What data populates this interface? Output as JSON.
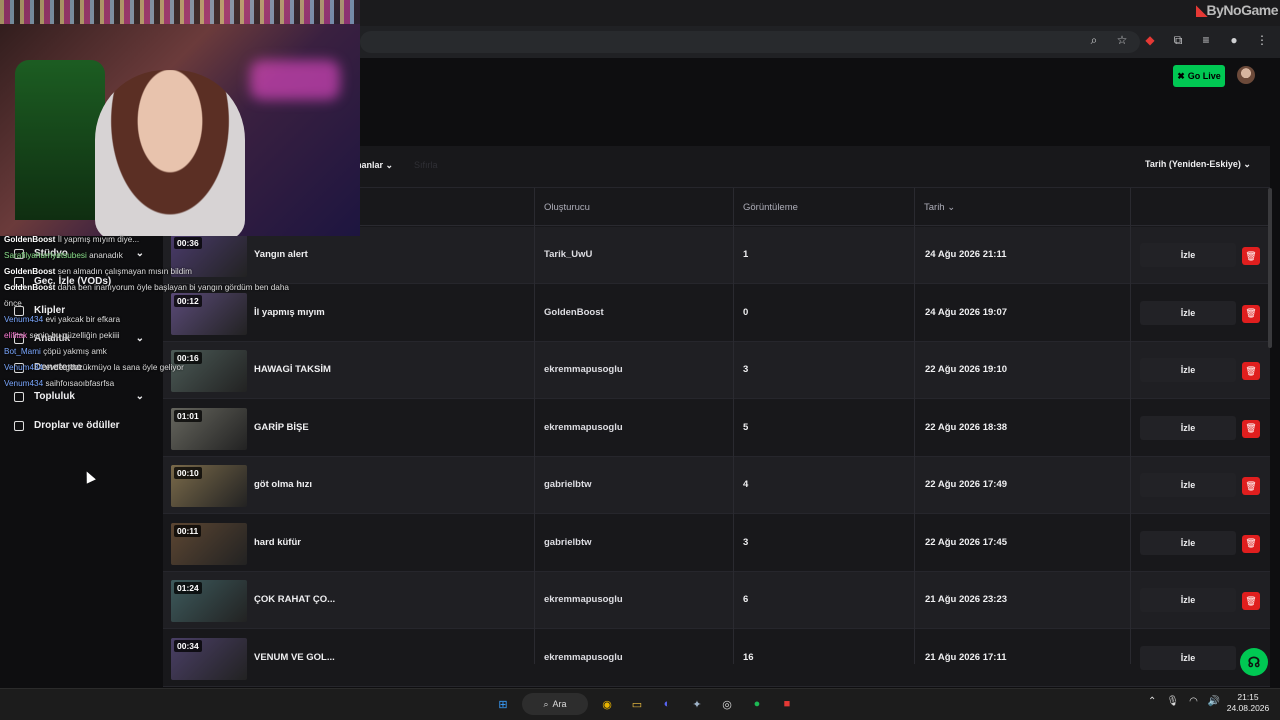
{
  "browser": {
    "watermark": "ByNoGame",
    "icons": [
      "zoom-icon",
      "star-icon",
      "extension-icon",
      "puzzle-icon",
      "media-icon",
      "profile-icon",
      "menu-icon"
    ]
  },
  "header": {
    "go_live_label": "Go Live"
  },
  "sidebar": {
    "items": [
      {
        "label": "Stüdyo",
        "icon": "studio-icon",
        "chevron": true
      },
      {
        "label": "Geç. İzle (VODs)",
        "icon": "vod-icon",
        "chevron": false
      },
      {
        "label": "Klipler",
        "icon": "clip-icon",
        "chevron": false
      },
      {
        "label": "Analitik",
        "icon": "chart-icon",
        "chevron": true
      },
      {
        "label": "Deneteme",
        "icon": "pen-icon",
        "chevron": false
      },
      {
        "label": "Topluluk",
        "icon": "people-icon",
        "chevron": true
      },
      {
        "label": "Droplar ve ödüller",
        "icon": "gift-icon",
        "chevron": false
      }
    ]
  },
  "chat": [
    {
      "user": "GoldenBoost",
      "text": "İl yapmış mıyım diye...",
      "cls": "u1"
    },
    {
      "user": "Sarafilyahurriyetsubesi",
      "text": "ananadık",
      "cls": "u2"
    },
    {
      "user": "GoldenBoost",
      "text": "sen almadın çalışmayan mısın bildim",
      "cls": "u1"
    },
    {
      "user": "GoldenBoost",
      "text": "daha ben inanıyorum öyle başlayan bi yangın gördüm ben daha",
      "cls": "u1"
    },
    {
      "user": "",
      "text": "önce",
      "cls": ""
    },
    {
      "user": "Venum434",
      "text": "evi yakcak bir efkara",
      "cls": "u3"
    },
    {
      "user": "elifitak",
      "text": "senin bu güzelliğin pekiiii",
      "cls": "u4"
    },
    {
      "user": "Bot_Mami",
      "text": "çöpü yakmış amk",
      "cls": "u3"
    },
    {
      "user": "Venum434",
      "text": "evde gözzükmüyo la sana öyle geliyor",
      "cls": "u3"
    },
    {
      "user": "Venum434",
      "text": "saihfoısaoıbfasrfsa",
      "cls": "u3"
    }
  ],
  "filters": {
    "left_label": "nanlar",
    "left_label_2": "Sıfırla",
    "sort_label": "Tarih (Yeniden-Eskiye)"
  },
  "table": {
    "headers": {
      "creator": "Oluşturucu",
      "views": "Görüntüleme",
      "date": "Tarih"
    },
    "watch_label": "İzle",
    "rows": [
      {
        "duration": "00:36",
        "title": "Yangın alert",
        "creator": "Tarik_UwU",
        "views": "1",
        "date": "24 Ağu 2026 21:11",
        "thumb": "#4a3b6b"
      },
      {
        "duration": "00:12",
        "title": "İl yapmış mıyım",
        "creator": "GoldenBoost",
        "views": "0",
        "date": "24 Ağu 2026 19:07",
        "thumb": "#5a4a78"
      },
      {
        "duration": "00:16",
        "title": "HAWAGİ TAKSİM",
        "creator": "ekremmapusoglu",
        "views": "3",
        "date": "22 Ağu 2026 19:10",
        "thumb": "#4b5a56"
      },
      {
        "duration": "01:01",
        "title": "GARİP BİŞE",
        "creator": "ekremmapusoglu",
        "views": "5",
        "date": "22 Ağu 2026 18:38",
        "thumb": "#66665e"
      },
      {
        "duration": "00:10",
        "title": "göt olma hızı",
        "creator": "gabrielbtw",
        "views": "4",
        "date": "22 Ağu 2026 17:49",
        "thumb": "#7a6a4a"
      },
      {
        "duration": "00:11",
        "title": "hard küfür",
        "creator": "gabrielbtw",
        "views": "3",
        "date": "22 Ağu 2026 17:45",
        "thumb": "#5c4632"
      },
      {
        "duration": "01:24",
        "title": "ÇOK RAHAT ÇO...",
        "creator": "ekremmapusoglu",
        "views": "6",
        "date": "21 Ağu 2026 23:23",
        "thumb": "#3d5a5c"
      },
      {
        "duration": "00:34",
        "title": "VENUM VE GOL...",
        "creator": "ekremmapusoglu",
        "views": "16",
        "date": "21 Ağu 2026 17:11",
        "thumb": "#4a3f66"
      }
    ]
  },
  "taskbar": {
    "search_label": "Ara",
    "time": "21:15",
    "date": "24.08.2026",
    "apps": [
      {
        "name": "windows-start-icon",
        "glyph": "⊞",
        "color": "#3aa0ff"
      },
      {
        "name": "chrome-icon",
        "glyph": "◉",
        "color": "#e8b400"
      },
      {
        "name": "file-explorer-icon",
        "glyph": "▭",
        "color": "#f5c542"
      },
      {
        "name": "discord-icon",
        "glyph": "◐",
        "color": "#5865f2"
      },
      {
        "name": "obs-settings-icon",
        "glyph": "✦",
        "color": "#9fb3c8"
      },
      {
        "name": "obs-icon",
        "glyph": "◎",
        "color": "#dddddd"
      },
      {
        "name": "spotify-icon",
        "glyph": "●",
        "color": "#1db954"
      },
      {
        "name": "app-red-icon",
        "glyph": "■",
        "color": "#e53935"
      }
    ]
  }
}
